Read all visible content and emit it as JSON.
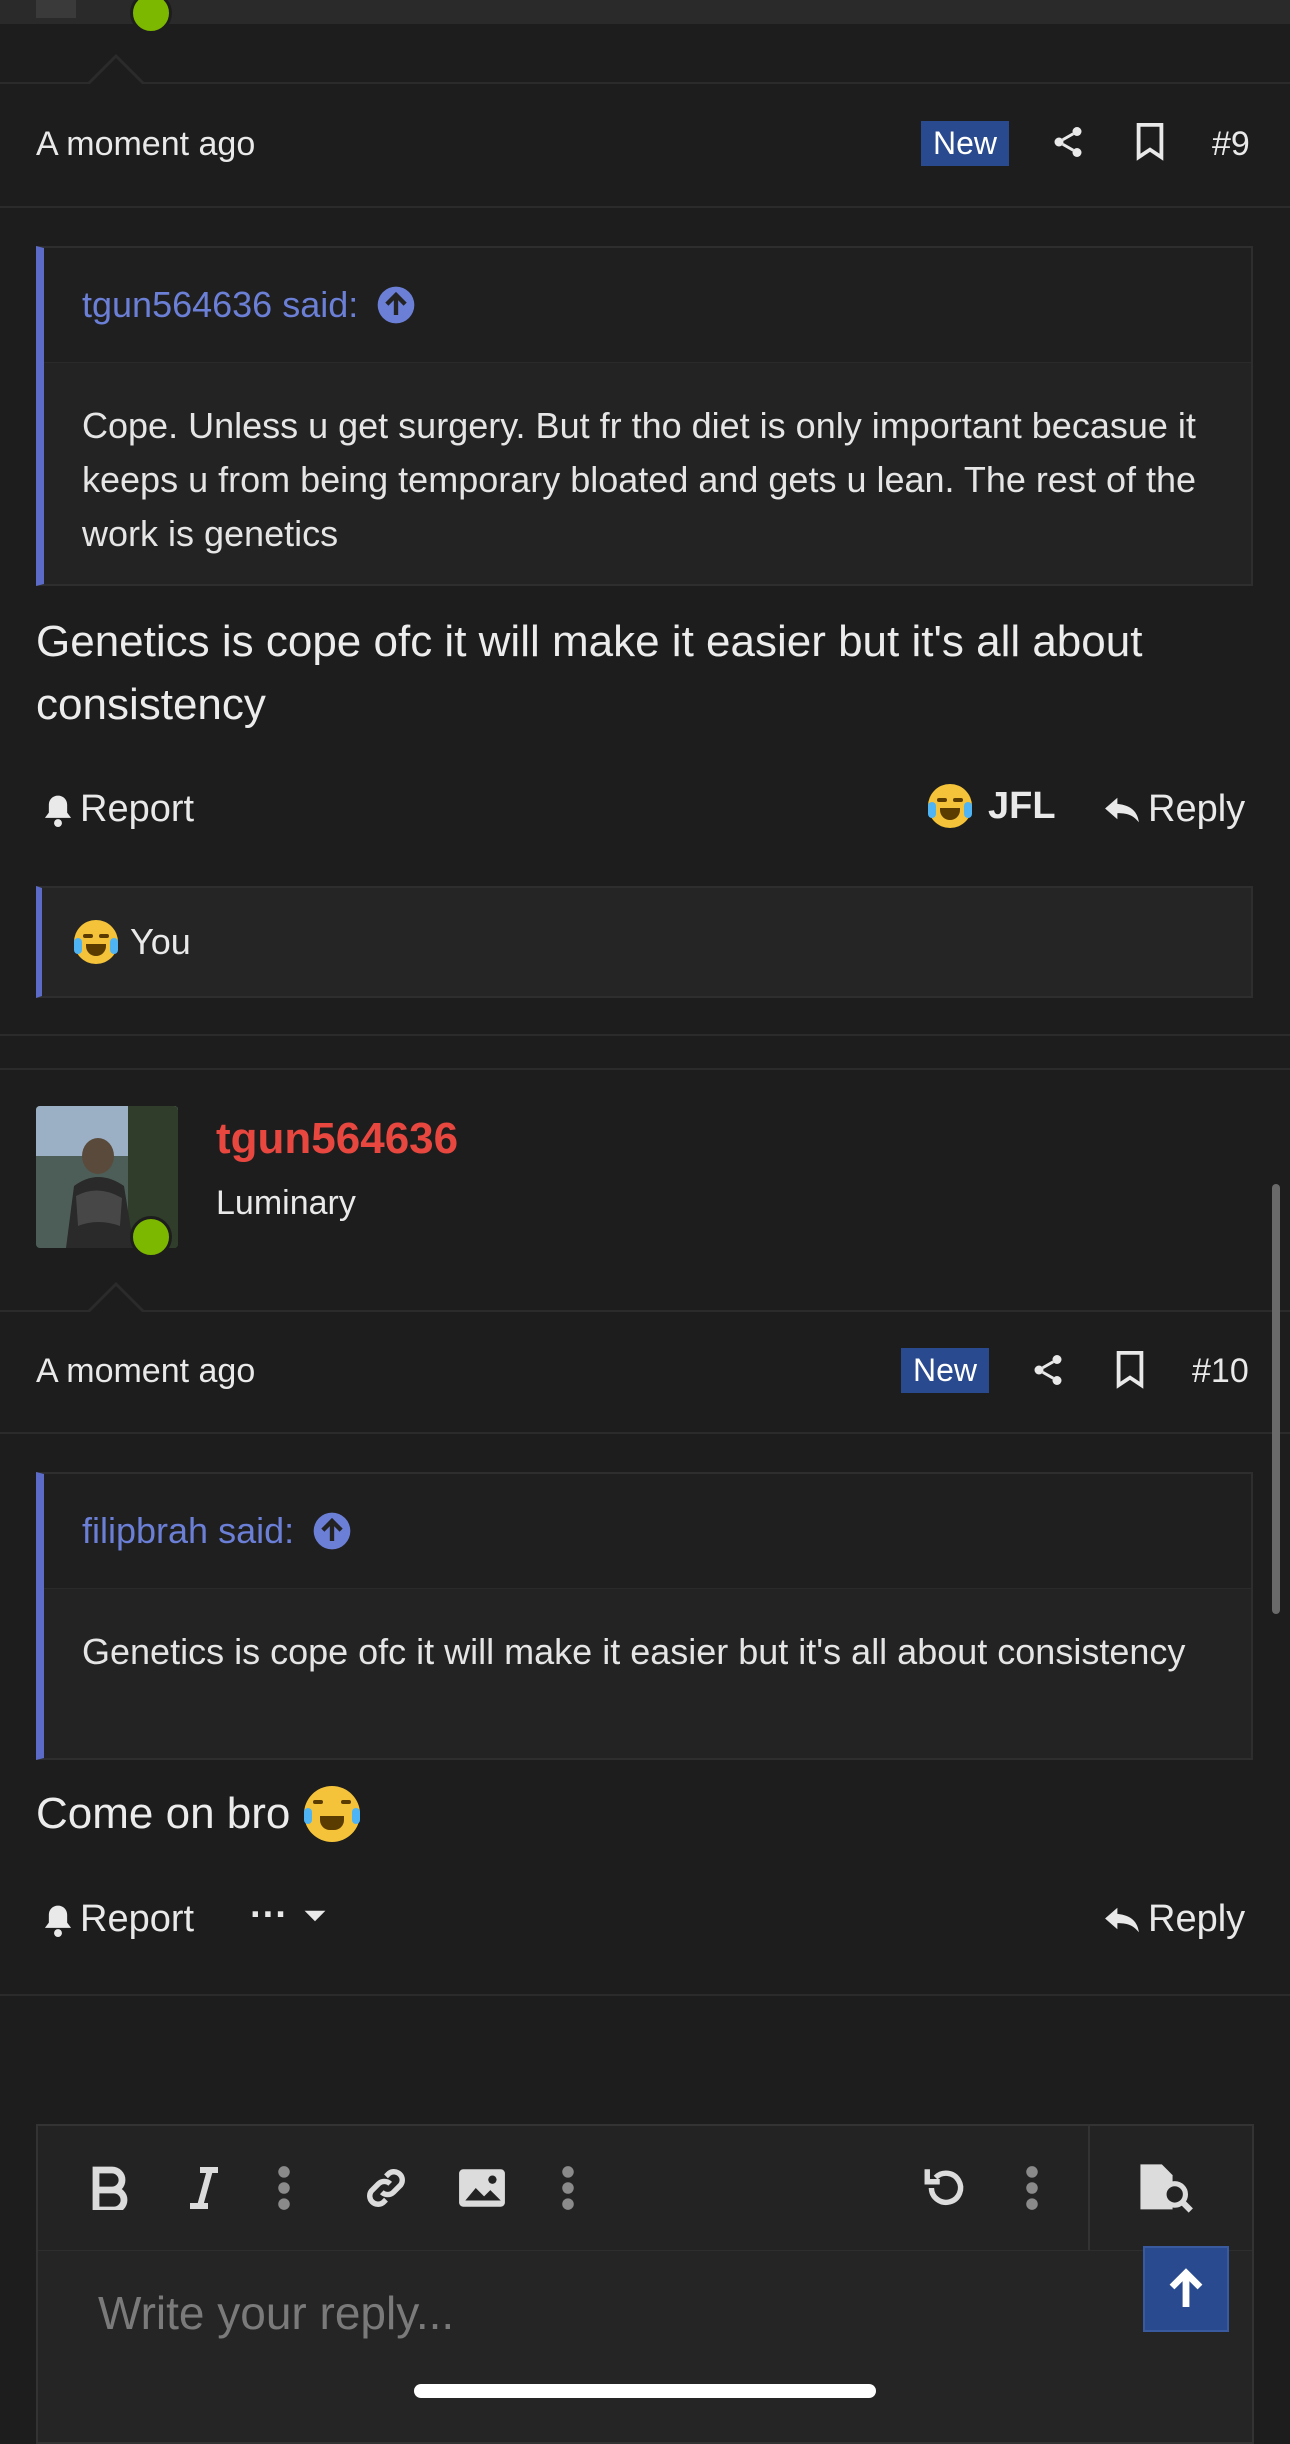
{
  "post9": {
    "time": "A moment ago",
    "badge": "New",
    "number": "#9",
    "quote": {
      "author": "tgun564636 said:",
      "text": "Cope. Unless u get surgery. But fr tho diet is only important becasue it keeps u from being temporary bloated and gets u lean. The rest of the work is genetics"
    },
    "body": "Genetics is cope ofc it will make it easier but it's all about consistency",
    "actions": {
      "report": "Report",
      "reaction": "JFL",
      "reply": "Reply"
    },
    "reactions_by": "You"
  },
  "post10": {
    "username": "tgun564636",
    "user_title": "Luminary",
    "time": "A moment ago",
    "badge": "New",
    "number": "#10",
    "quote": {
      "author": "filipbrah said:",
      "text": "Genetics is cope ofc it will make it easier but it's all about consistency"
    },
    "body": "Come on bro",
    "actions": {
      "report": "Report",
      "more": "···",
      "reply": "Reply"
    }
  },
  "editor": {
    "placeholder": "Write your reply...",
    "toolbar_icons": [
      "bold-icon",
      "italic-icon",
      "more-vertical-icon",
      "link-icon",
      "image-icon",
      "more-vertical-icon",
      "undo-icon",
      "more-vertical-icon",
      "preview-icon"
    ]
  },
  "colors": {
    "accent": "#5b6bc7",
    "username": "#e8473f",
    "online": "#7cb800",
    "badge": "#2a4a8f"
  }
}
